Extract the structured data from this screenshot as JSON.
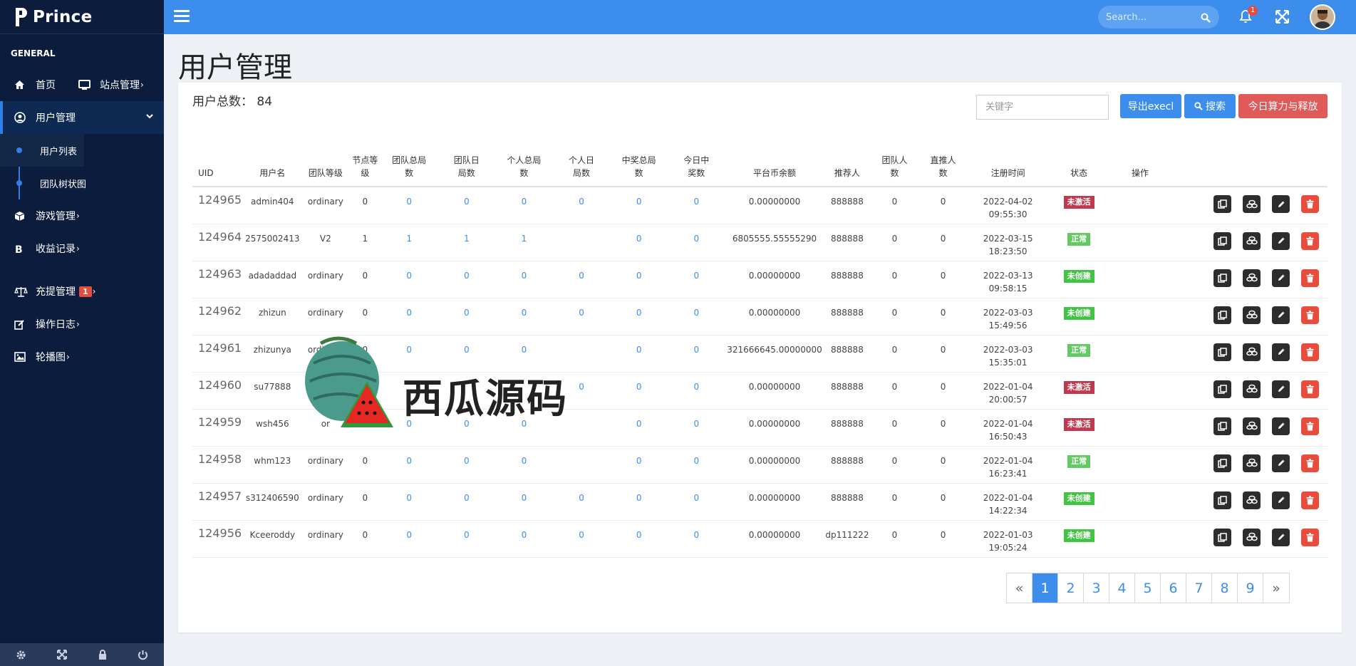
{
  "brand": {
    "name": "Prince"
  },
  "sidebar": {
    "section": "GENERAL",
    "home": "首页",
    "site": "站点管理",
    "user_mgmt": "用户管理",
    "sub_items": [
      "用户列表",
      "团队树状图"
    ],
    "game": "游戏管理",
    "income": "收益记录",
    "recharge": "充提管理",
    "recharge_badge": "1",
    "oplog": "操作日志",
    "carousel": "轮播图",
    "arrow": "›"
  },
  "topbar": {
    "search_placeholder": "Search...",
    "notification_count": "1"
  },
  "page": {
    "title": "用户管理"
  },
  "main": {
    "total_label": "用户总数：",
    "total_value": "84",
    "keyword_placeholder": "关键字",
    "export_label": "导出execl",
    "search_label": "搜索",
    "today_label": "今日算力与释放"
  },
  "table": {
    "headers": [
      "UID",
      "用户名",
      "团队等级",
      "节点等级",
      "团队总局数",
      "团队日局数",
      "个人总局数",
      "个人日局数",
      "中奖总局数",
      "今日中奖数",
      "平台币余额",
      "推荐人",
      "团队人数",
      "直推人数",
      "注册时间",
      "状态",
      "操作"
    ],
    "rows": [
      {
        "uid": "124965",
        "username": "admin404",
        "team_level": "ordinary",
        "node_level": "0",
        "team_total": "0",
        "team_day": "0",
        "person_total": "0",
        "person_day": "0",
        "win_total": "0",
        "win_today": "0",
        "balance": "0.00000000",
        "referrer": "888888",
        "team_count": "0",
        "direct_count": "0",
        "reg_date": "2022-04-02",
        "reg_time": "09:55:30",
        "status": "未激活"
      },
      {
        "uid": "124964",
        "username": "2575002413",
        "team_level": "V2",
        "node_level": "1",
        "team_total": "1",
        "team_day": "1",
        "person_total": "1",
        "person_day": "",
        "win_total": "0",
        "win_today": "0",
        "balance": "6805555.55555290",
        "referrer": "888888",
        "team_count": "0",
        "direct_count": "0",
        "reg_date": "2022-03-15",
        "reg_time": "18:23:50",
        "status": "正常"
      },
      {
        "uid": "124963",
        "username": "adadaddad",
        "team_level": "ordinary",
        "node_level": "0",
        "team_total": "0",
        "team_day": "0",
        "person_total": "0",
        "person_day": "0",
        "win_total": "0",
        "win_today": "0",
        "balance": "0.00000000",
        "referrer": "888888",
        "team_count": "0",
        "direct_count": "0",
        "reg_date": "2022-03-13",
        "reg_time": "09:58:15",
        "status": "未创建"
      },
      {
        "uid": "124962",
        "username": "zhizun",
        "team_level": "ordinary",
        "node_level": "0",
        "team_total": "0",
        "team_day": "0",
        "person_total": "0",
        "person_day": "0",
        "win_total": "0",
        "win_today": "0",
        "balance": "0.00000000",
        "referrer": "888888",
        "team_count": "0",
        "direct_count": "0",
        "reg_date": "2022-03-03",
        "reg_time": "15:49:56",
        "status": "未创建"
      },
      {
        "uid": "124961",
        "username": "zhizunya",
        "team_level": "ordinary",
        "node_level": "0",
        "team_total": "0",
        "team_day": "0",
        "person_total": "0",
        "person_day": "",
        "win_total": "0",
        "win_today": "0",
        "balance": "321666645.00000000",
        "referrer": "888888",
        "team_count": "0",
        "direct_count": "0",
        "reg_date": "2022-03-03",
        "reg_time": "15:35:01",
        "status": "正常"
      },
      {
        "uid": "124960",
        "username": "su77888",
        "team_level": "",
        "node_level": "",
        "team_total": "",
        "team_day": "",
        "person_total": "",
        "person_day": "0",
        "win_total": "0",
        "win_today": "0",
        "balance": "0.00000000",
        "referrer": "888888",
        "team_count": "0",
        "direct_count": "0",
        "reg_date": "2022-01-04",
        "reg_time": "20:00:57",
        "status": "未激活"
      },
      {
        "uid": "124959",
        "username": "wsh456",
        "team_level": "or",
        "node_level": "",
        "team_total": "0",
        "team_day": "0",
        "person_total": "0",
        "person_day": "",
        "win_total": "0",
        "win_today": "0",
        "balance": "0.00000000",
        "referrer": "888888",
        "team_count": "0",
        "direct_count": "0",
        "reg_date": "2022-01-04",
        "reg_time": "16:50:43",
        "status": "未激活"
      },
      {
        "uid": "124958",
        "username": "whm123",
        "team_level": "ordinary",
        "node_level": "0",
        "team_total": "0",
        "team_day": "0",
        "person_total": "0",
        "person_day": "",
        "win_total": "0",
        "win_today": "0",
        "balance": "0.00000000",
        "referrer": "888888",
        "team_count": "0",
        "direct_count": "0",
        "reg_date": "2022-01-04",
        "reg_time": "16:23:41",
        "status": "正常"
      },
      {
        "uid": "124957",
        "username": "s312406590",
        "team_level": "ordinary",
        "node_level": "0",
        "team_total": "0",
        "team_day": "0",
        "person_total": "0",
        "person_day": "0",
        "win_total": "0",
        "win_today": "0",
        "balance": "0.00000000",
        "referrer": "888888",
        "team_count": "0",
        "direct_count": "0",
        "reg_date": "2022-01-04",
        "reg_time": "14:22:34",
        "status": "未创建"
      },
      {
        "uid": "124956",
        "username": "Kceeroddy",
        "team_level": "ordinary",
        "node_level": "0",
        "team_total": "0",
        "team_day": "0",
        "person_total": "0",
        "person_day": "0",
        "win_total": "0",
        "win_today": "0",
        "balance": "0.00000000",
        "referrer": "dp111222",
        "team_count": "0",
        "direct_count": "0",
        "reg_date": "2022-01-03",
        "reg_time": "19:05:24",
        "status": "未创建"
      }
    ]
  },
  "status_colors": {
    "未激活": "#c0394f",
    "正常": "#64c964",
    "未创建": "#43c343"
  },
  "pagination": {
    "prev": "«",
    "pages": [
      "1",
      "2",
      "3",
      "4",
      "5",
      "6",
      "7",
      "8",
      "9"
    ],
    "active": "1",
    "next": "»"
  },
  "watermark": {
    "text": "西瓜源码"
  },
  "colors": {
    "primary": "#3c8dec",
    "sidebar": "#0b1c3d",
    "danger": "#e05a5a"
  }
}
